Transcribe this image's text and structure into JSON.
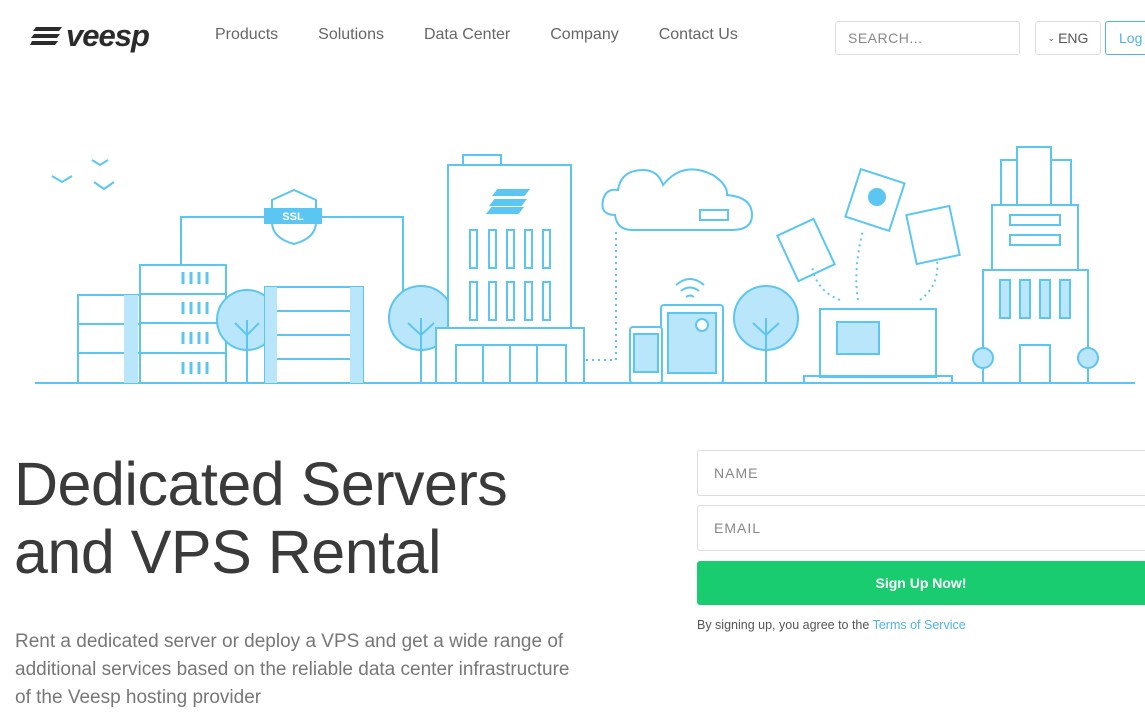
{
  "header": {
    "logo": "veesp",
    "nav": [
      "Products",
      "Solutions",
      "Data Center",
      "Company",
      "Contact Us"
    ],
    "search_placeholder": "SEARCH...",
    "lang": "ENG",
    "login": "Log"
  },
  "hero": {
    "title_line1": "Dedicated Servers",
    "title_line2": "and VPS Rental",
    "description": "Rent a dedicated server or deploy a VPS and get a wide range of additional services based on the reliable data center infrastructure of the Veesp hosting provider",
    "ssl_label": "SSL"
  },
  "form": {
    "name_placeholder": "NAME",
    "email_placeholder": "EMAIL",
    "submit": "Sign Up Now!",
    "terms_prefix": "By signing up, you agree to the ",
    "terms_link": "Terms of Service"
  },
  "colors": {
    "accent": "#4fb3e8",
    "green": "#19cc70",
    "illus": "#5cc6f2"
  }
}
